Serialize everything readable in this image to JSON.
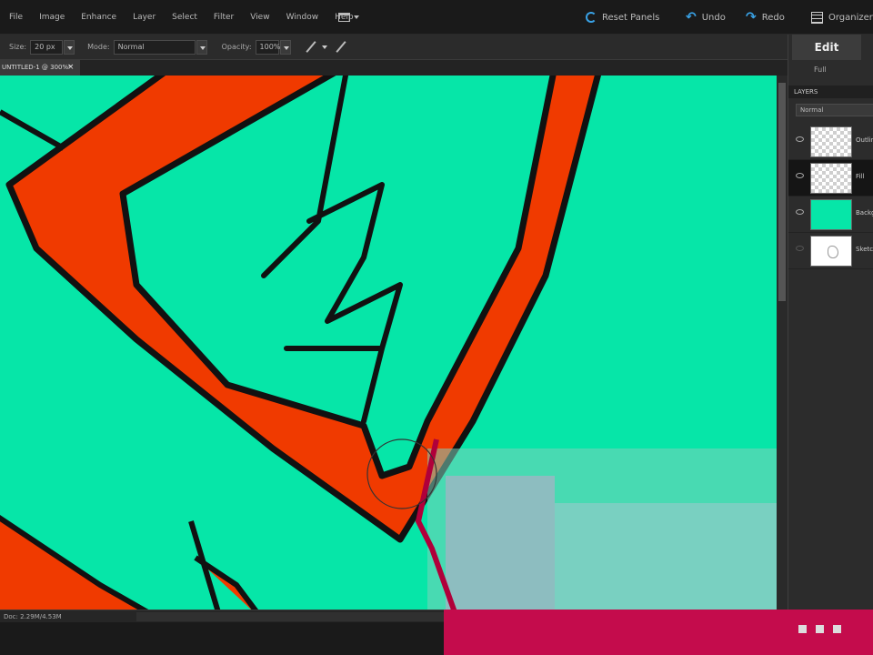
{
  "menubar": {
    "items": [
      "File",
      "Image",
      "Enhance",
      "Layer",
      "Select",
      "Filter",
      "View",
      "Window",
      "Help"
    ],
    "reset_panels": "Reset Panels",
    "undo": "Undo",
    "redo": "Redo",
    "organizer": "Organizer"
  },
  "options": {
    "size_label": "Size:",
    "size_value": "20 px",
    "mode_label": "Mode:",
    "mode_value": "Normal",
    "opacity_label": "Opacity:",
    "opacity_value": "100%"
  },
  "document": {
    "tab_label": "UNTITLED-1 @ 300%*",
    "close": "×",
    "status_text": "Doc: 2.29M/4.53M"
  },
  "panel": {
    "edit_tab": "Edit",
    "sub_tab": "Full",
    "layers_header": "LAYERS",
    "blend_mode": "Normal",
    "layers": [
      {
        "name": "Outline",
        "thumb": "check",
        "visible": true,
        "active": false
      },
      {
        "name": "Fill",
        "thumb": "check",
        "visible": true,
        "active": true
      },
      {
        "name": "Background",
        "thumb": "teal",
        "visible": true,
        "active": false
      },
      {
        "name": "Sketch",
        "thumb": "white",
        "visible": false,
        "active": false
      }
    ]
  },
  "colors": {
    "canvas_teal": "#06e6a8",
    "fill_orange": "#f03a00",
    "outline": "#111111",
    "accent_blue": "#39a2e6",
    "magenta": "#c40c4c"
  }
}
